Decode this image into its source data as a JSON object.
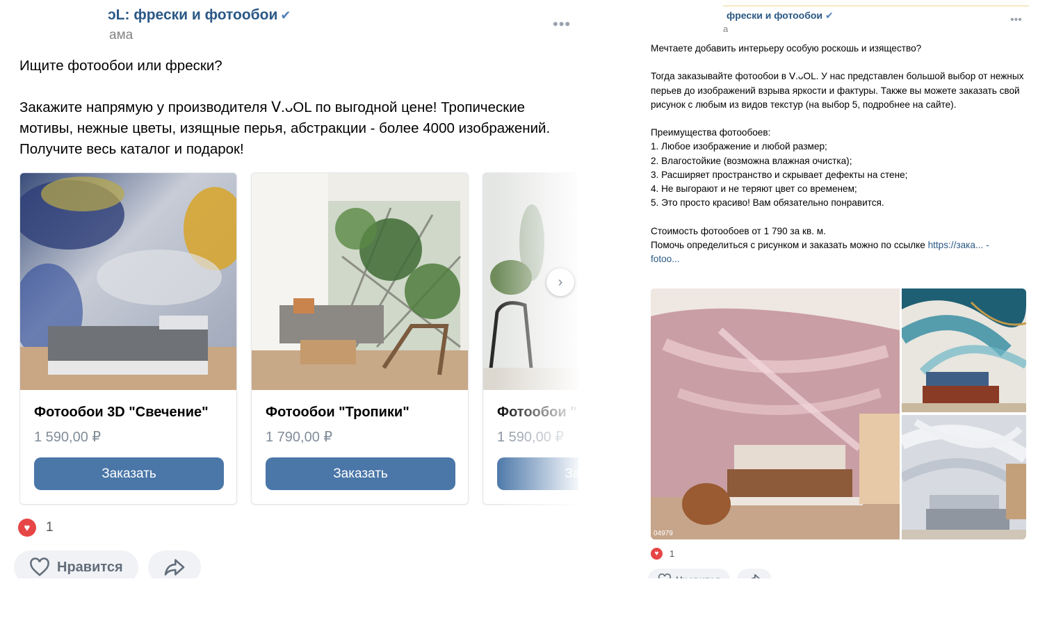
{
  "left_post": {
    "author": "ᴐL: фрески и фотообои",
    "verified_icon": "checkmark-icon",
    "subtitle": "ама",
    "text": "Ищите фотообои или фрески?\n\nЗакажите напрямую у производителя ᐯ.ᴗOL по выгодной цене! Тропические мотивы, нежные цветы, изящные перья, абстракции - более 4000 изображений. Получите весь каталог и подарок!",
    "cards": [
      {
        "title": "Фотообои 3D \"Свечение\"",
        "price": "1 590,00 ₽",
        "button": "Заказать"
      },
      {
        "title": "Фотообои \"Тропики\"",
        "price": "1 790,00 ₽",
        "button": "Заказать"
      },
      {
        "title": "Фотообои \"",
        "price": "1 590,00 ₽",
        "button": "Заказать"
      }
    ],
    "likes_count": "1",
    "like_button": "Нравится"
  },
  "right_post": {
    "author": "фрески и фотообои",
    "subtitle": "а",
    "text_main": "Мечтаете добавить интерьеру особую роскошь и изящество?\n\nТогда заказывайте фотообои в ᐯ.ᴗOL. У нас представлен большой выбор от нежных перьев до изображений взрыва яркости и фактуры. Также вы можете заказать свой рисунок с любым из видов текстур (на выбор 5, подробнее на сайте).\n\nПреимущества фотообоев:\n1. Любое изображение и любой размер;\n2. Влагостойкие (возможна влажная очистка);\n3. Расширяет пространство и скрывает дефекты на стене;\n4. Не выгорают и не теряют цвет со временем;\n5. Это просто красиво! Вам обязательно понравится.\n\nСтоимость фотообоев от 1 790 за кв. м.\nПомочь определиться с рисунком и заказать можно по ссылке ",
    "link_text": "https://зака... -\nfotoo...",
    "image_code": "04979",
    "likes_count": "1",
    "like_button": "Нравится"
  },
  "colors": {
    "accent": "#4a76a8",
    "link": "#2a5885",
    "heart": "#e64646"
  }
}
